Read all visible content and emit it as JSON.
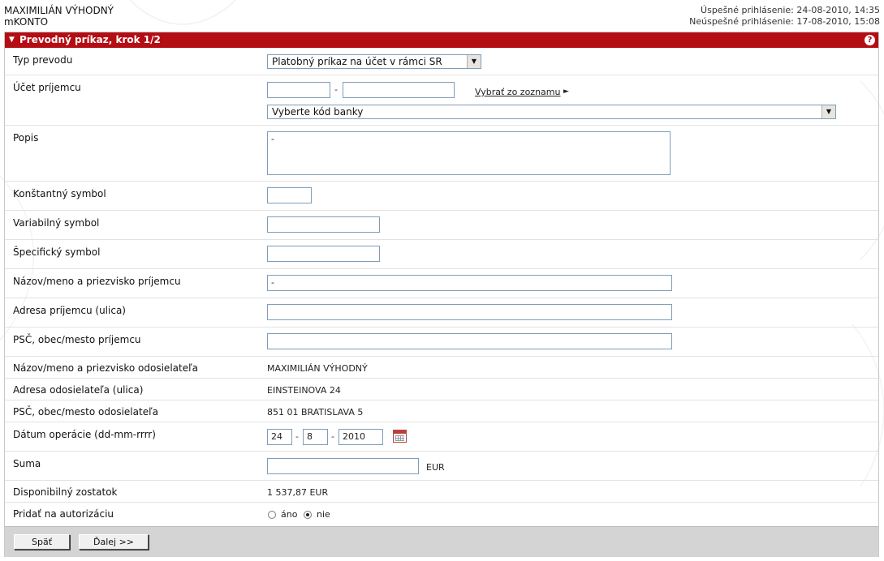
{
  "header": {
    "user_name": "MAXIMILIÁN VÝHODNÝ",
    "product": "mKONTO",
    "last_login_ok": "Úspešné prihlásenie: 24-08-2010, 14:35",
    "last_login_fail": "Neúspešné prihlásenie: 17-08-2010, 15:08"
  },
  "panel": {
    "title": "Prevodný príkaz, krok 1/2",
    "help_icon": "question-mark-icon",
    "collapse_icon": "triangle-down-icon"
  },
  "form": {
    "transfer_type": {
      "label": "Typ prevodu",
      "value": "Platobný príkaz na účet v rámci SR"
    },
    "recipient_account": {
      "label": "Účet príjemcu",
      "prefix": "",
      "number": "",
      "separator": "-",
      "select_from_list": "Vybrať zo zoznamu",
      "bank_code": "Vyberte kód banky"
    },
    "description": {
      "label": "Popis",
      "value": "-"
    },
    "constant_symbol": {
      "label": "Konštantný symbol",
      "value": ""
    },
    "variable_symbol": {
      "label": "Variabilný symbol",
      "value": ""
    },
    "specific_symbol": {
      "label": "Špecifický symbol",
      "value": ""
    },
    "recipient_name": {
      "label": "Názov/meno a priezvisko príjemcu",
      "value": "-"
    },
    "recipient_street": {
      "label": "Adresa príjemcu (ulica)",
      "value": ""
    },
    "recipient_city": {
      "label": "PSČ, obec/mesto príjemcu",
      "value": ""
    },
    "sender_name": {
      "label": "Názov/meno a priezvisko odosielateľa",
      "value": "MAXIMILIÁN VÝHODNÝ"
    },
    "sender_street": {
      "label": "Adresa odosielateľa (ulica)",
      "value": "EINSTEINOVA 24"
    },
    "sender_city": {
      "label": "PSČ, obec/mesto odosielateľa",
      "value": "851 01 BRATISLAVA 5"
    },
    "operation_date": {
      "label": "Dátum operácie (dd-mm-rrrr)",
      "day": "24",
      "month": "8",
      "year": "2010",
      "separator": "-"
    },
    "amount": {
      "label": "Suma",
      "value": "",
      "currency": "EUR"
    },
    "available_balance": {
      "label": "Disponibilný zostatok",
      "value": "1 537,87 EUR"
    },
    "authorization": {
      "label": "Pridať na autorizáciu",
      "option_yes": "áno",
      "option_no": "nie",
      "selected": "nie"
    }
  },
  "buttons": {
    "back": "Späť",
    "next": "Ďalej >>"
  },
  "colors": {
    "accent": "#b40d13",
    "footer": "#d4d4d4",
    "input_border": "#7f9db9"
  }
}
